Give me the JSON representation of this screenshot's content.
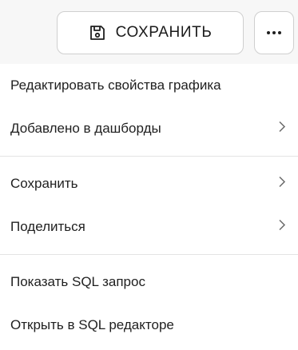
{
  "toolbar": {
    "save_label": "СОХРАНИТЬ",
    "save_icon": "floppy-disk-icon",
    "more_icon": "more-horizontal-icon"
  },
  "menu": {
    "groups": [
      [
        {
          "label": "Редактировать свойства графика",
          "has_submenu": false
        },
        {
          "label": "Добавлено в дашборды",
          "has_submenu": true
        }
      ],
      [
        {
          "label": "Сохранить",
          "has_submenu": true
        },
        {
          "label": "Поделиться",
          "has_submenu": true
        }
      ],
      [
        {
          "label": "Показать SQL запрос",
          "has_submenu": false
        },
        {
          "label": "Открыть в SQL редакторе",
          "has_submenu": false
        }
      ]
    ]
  }
}
